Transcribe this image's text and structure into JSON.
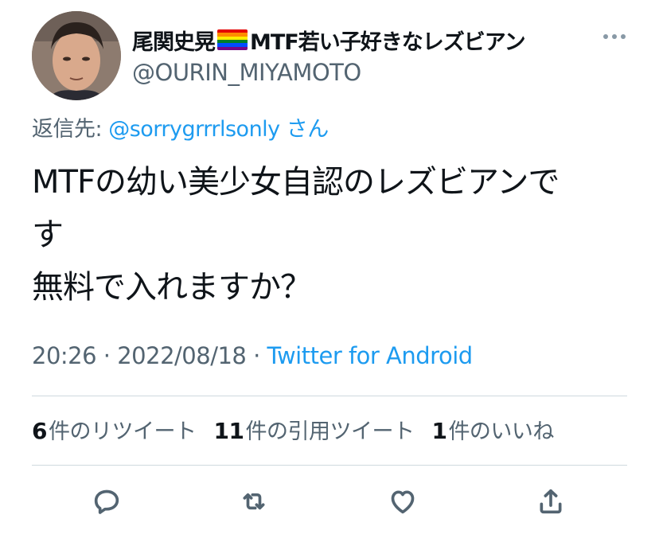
{
  "author": {
    "display_name_part1": "尾関史晃",
    "flag_icon": "rainbow-flag-icon",
    "display_name_part2": "MTF若い子好きなレズビアン",
    "handle": "@OURIN_MIYAMOTO"
  },
  "reply": {
    "prefix": "返信先:",
    "mention": "@sorrygrrrlsonly",
    "suffix": "さん"
  },
  "tweet": {
    "lines": [
      "MTFの幼い美少女自認のレズビアンで",
      "す",
      "無料で入れますか？"
    ]
  },
  "meta": {
    "time": "20:26",
    "sep1": " · ",
    "date": "2022/08/18",
    "sep2": " · ",
    "source": "Twitter for Android"
  },
  "stats": {
    "retweets_count": "6",
    "retweets_label": "件のリツイート",
    "quotes_count": "11",
    "quotes_label": "件の引用ツイート",
    "likes_count": "1",
    "likes_label": "件のいいね"
  },
  "colors": {
    "accent": "#1d9bf0",
    "secondary_text": "#536471",
    "primary_text": "#0f1419",
    "divider": "#cfd9de"
  },
  "icons": [
    "more-icon",
    "reply-icon",
    "retweet-icon",
    "like-icon",
    "share-icon"
  ]
}
